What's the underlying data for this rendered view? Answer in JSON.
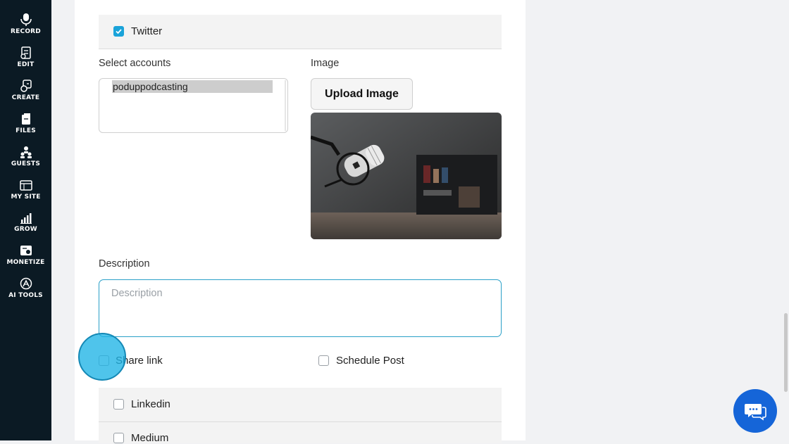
{
  "sidebar": {
    "items": [
      {
        "label": "RECORD",
        "icon": "microphone-icon"
      },
      {
        "label": "EDIT",
        "icon": "edit-document-icon"
      },
      {
        "label": "CREATE",
        "icon": "create-icon"
      },
      {
        "label": "FILES",
        "icon": "files-icon"
      },
      {
        "label": "GUESTS",
        "icon": "guests-icon"
      },
      {
        "label": "MY SITE",
        "icon": "website-icon"
      },
      {
        "label": "GROW",
        "icon": "bar-chart-icon"
      },
      {
        "label": "MONETIZE",
        "icon": "monetize-icon"
      },
      {
        "label": "AI TOOLS",
        "icon": "ai-tools-icon"
      }
    ]
  },
  "twitter": {
    "label": "Twitter",
    "checked": true
  },
  "accounts": {
    "label": "Select accounts",
    "selected": "poduppodcasting"
  },
  "image": {
    "label": "Image",
    "upload_label": "Upload Image",
    "preview": "microphone-photo"
  },
  "description": {
    "label": "Description",
    "placeholder": "Description"
  },
  "share_link": {
    "label": "Share link",
    "checked": false
  },
  "schedule_post": {
    "label": "Schedule Post",
    "checked": false
  },
  "linkedin": {
    "label": "Linkedin",
    "checked": false
  },
  "medium": {
    "label": "Medium",
    "checked": false
  },
  "colors": {
    "sidebar_bg": "#0b1a24",
    "accent": "#1aa3d9",
    "chat": "#1565d8"
  }
}
